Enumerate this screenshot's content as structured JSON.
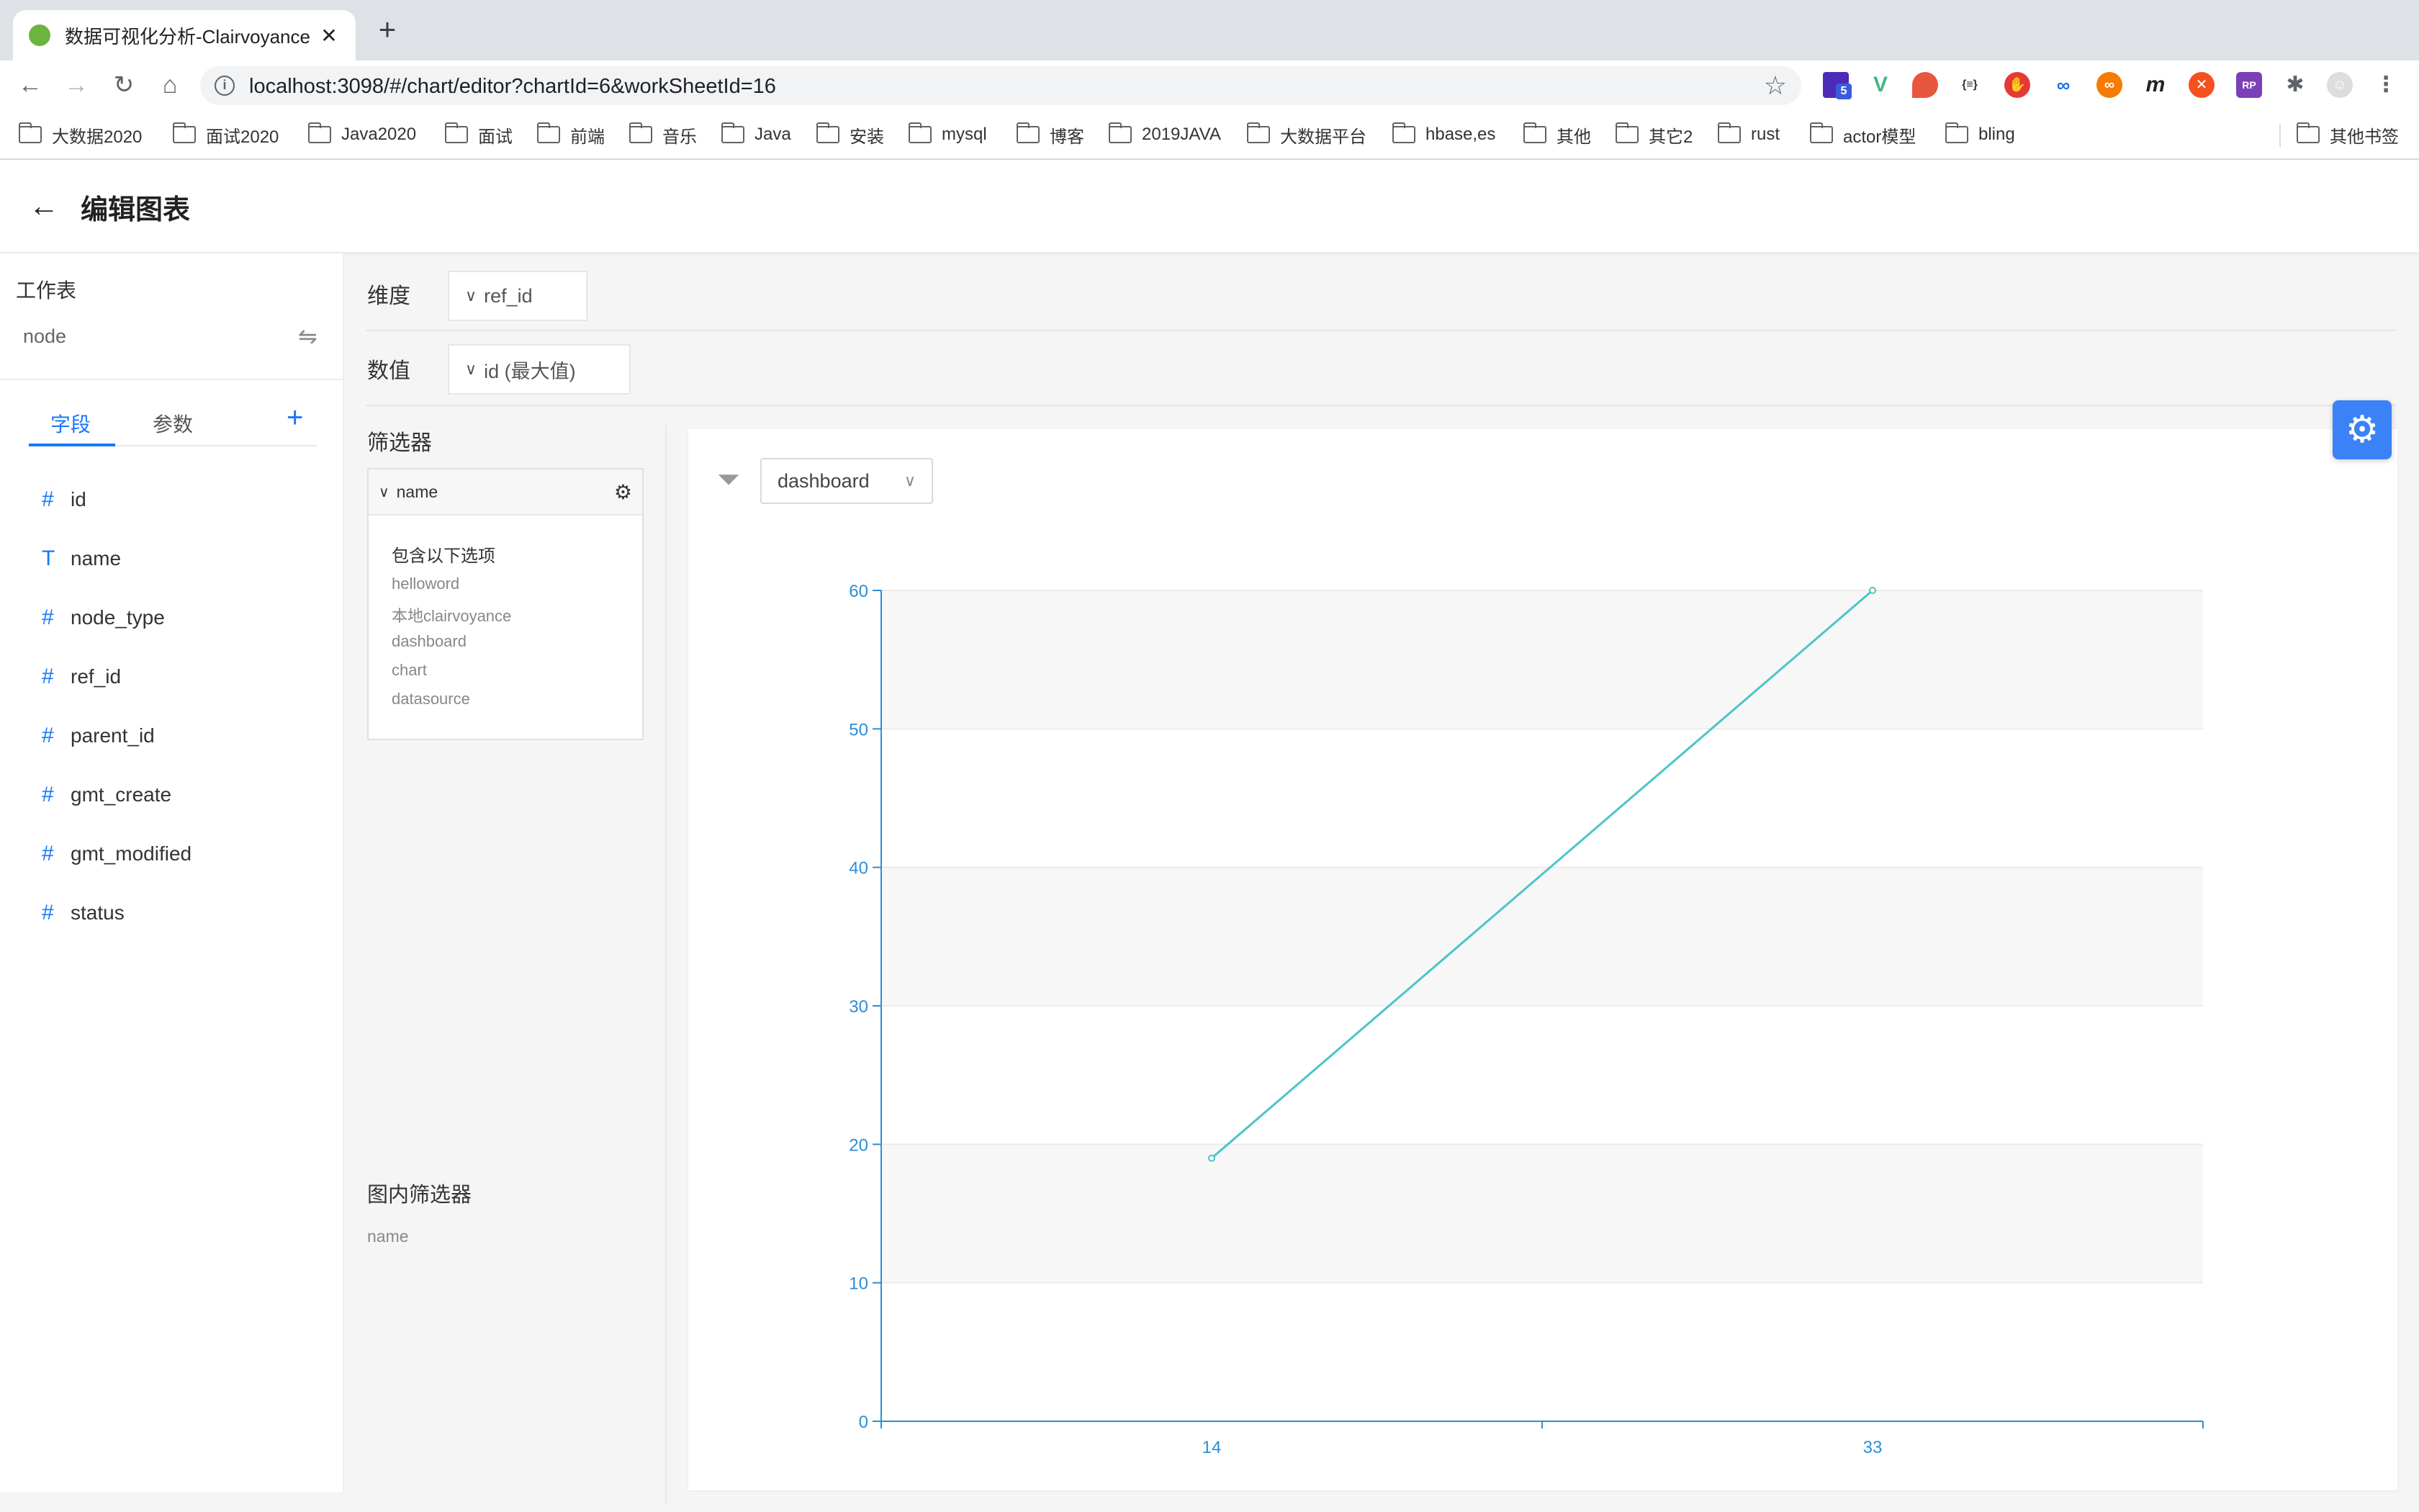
{
  "browser": {
    "tab_title": "数据可视化分析-Clairvoyance",
    "tab_close": "✕",
    "new_tab": "+",
    "url": "localhost:3098/#/chart/editor?chartId=6&workSheetId=16",
    "bookmarks": [
      "大数据2020",
      "面试2020",
      "Java2020",
      "面试",
      "前端",
      "音乐",
      "Java",
      "安装",
      "mysql",
      "博客",
      "2019JAVA",
      "大数据平台",
      "hbase,es",
      "其他",
      "其它2",
      "rust",
      "actor模型",
      "bling"
    ],
    "other_bookmarks": "其他书签",
    "extension_badge": "5",
    "extension_m": "m",
    "extension_rp": "RP",
    "extension_json": "{≡}"
  },
  "header": {
    "title": "编辑图表"
  },
  "sidebar": {
    "worksheet_label": "工作表",
    "worksheet_name": "node",
    "tabs": [
      "字段",
      "参数"
    ],
    "add_label": "+",
    "fields": [
      {
        "icon": "#",
        "name": "id"
      },
      {
        "icon": "T",
        "name": "name"
      },
      {
        "icon": "#",
        "name": "node_type"
      },
      {
        "icon": "#",
        "name": "ref_id"
      },
      {
        "icon": "#",
        "name": "parent_id"
      },
      {
        "icon": "#",
        "name": "gmt_create"
      },
      {
        "icon": "#",
        "name": "gmt_modified"
      },
      {
        "icon": "#",
        "name": "status"
      }
    ]
  },
  "shelves": {
    "dimension_label": "维度",
    "dimension_value": "ref_id",
    "measure_label": "数值",
    "measure_value": "id (最大值)"
  },
  "filters": {
    "label": "筛选器",
    "field": "name",
    "mode": "包含以下选项",
    "options": [
      "helloword",
      "本地clairvoyance",
      "dashboard",
      "chart",
      "datasource"
    ],
    "in_chart_label": "图内筛选器",
    "in_chart_field": "name"
  },
  "chart_filter": {
    "selected": "dashboard"
  },
  "chart_data": {
    "type": "line",
    "categories": [
      "14",
      "33"
    ],
    "series": [
      {
        "values": [
          19,
          60
        ]
      }
    ],
    "ylim": [
      0,
      60
    ],
    "yticks": [
      0,
      10,
      20,
      30,
      40,
      50,
      60
    ],
    "grid": true,
    "color": "#4cc4c9",
    "axis_color": "#2c8ed6"
  },
  "colors": {
    "accent": "#1677ff",
    "fab": "#3b82f6"
  }
}
